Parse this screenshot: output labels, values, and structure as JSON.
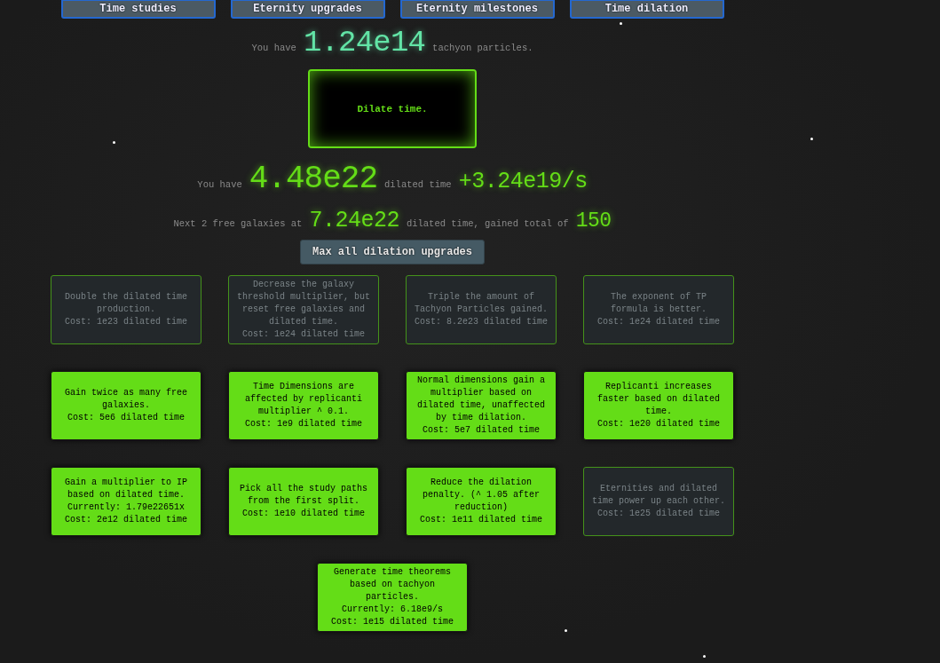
{
  "tabs": [
    "Time studies",
    "Eternity upgrades",
    "Eternity milestones",
    "Time dilation"
  ],
  "tachyons": {
    "label": "You have",
    "amount": "1.24e14",
    "unit": "tachyon particles."
  },
  "dilate_button": {
    "label": "Dilate time."
  },
  "dilated_time": {
    "label": "You have",
    "amount": "4.48e22",
    "unit": "dilated time",
    "rate": "+3.24e19/s"
  },
  "free_galaxies": {
    "label": "Next 2 free galaxies at",
    "threshold": "7.24e22",
    "unit": "dilated time, gained total of",
    "total": "150"
  },
  "max_button": {
    "label": "Max all dilation upgrades"
  },
  "upgrade_rows": [
    [
      {
        "description": "Double the dilated time production.",
        "cost": "Cost: 1e23 dilated time",
        "bought": false
      },
      {
        "description": "Decrease the galaxy threshold multiplier, but reset free galaxies and dilated time.",
        "cost": "Cost: 1e24 dilated time",
        "bought": false
      },
      {
        "description": "Triple the amount of Tachyon Particles gained.",
        "cost": "Cost: 8.2e23 dilated time",
        "bought": false
      },
      {
        "description": "The exponent of TP formula is better.",
        "cost": "Cost: 1e24 dilated time",
        "bought": false
      }
    ],
    [
      {
        "description": "Gain twice as many free galaxies.",
        "cost": "Cost: 5e6 dilated time",
        "bought": true
      },
      {
        "description": "Time Dimensions are affected by replicanti multiplier ^ 0.1.",
        "cost": "Cost: 1e9 dilated time",
        "bought": true
      },
      {
        "description": "Normal dimensions gain a multiplier based on dilated time, unaffected by time dilation.",
        "cost": "Cost: 5e7 dilated time",
        "bought": true
      },
      {
        "description": "Replicanti increases faster based on dilated time.",
        "cost": "Cost: 1e20 dilated time",
        "bought": true
      }
    ],
    [
      {
        "description": "Gain a multiplier to IP based on dilated time.",
        "current": "Currently: 1.79e22651x",
        "cost": "Cost: 2e12 dilated time",
        "bought": true
      },
      {
        "description": "Pick all the study paths from the first split.",
        "cost": "Cost: 1e10 dilated time",
        "bought": true
      },
      {
        "description": "Reduce the dilation penalty. (^ 1.05 after reduction)",
        "cost": "Cost: 1e11 dilated time",
        "bought": true
      },
      {
        "description": "Eternities and dilated time power up each other.",
        "cost": "Cost: 1e25 dilated time",
        "bought": false
      }
    ],
    [
      {
        "description": "Generate time theorems based on tachyon particles.",
        "current": "Currently: 6.18e9/s",
        "cost": "Cost: 1e15 dilated time",
        "bought": true
      }
    ]
  ]
}
